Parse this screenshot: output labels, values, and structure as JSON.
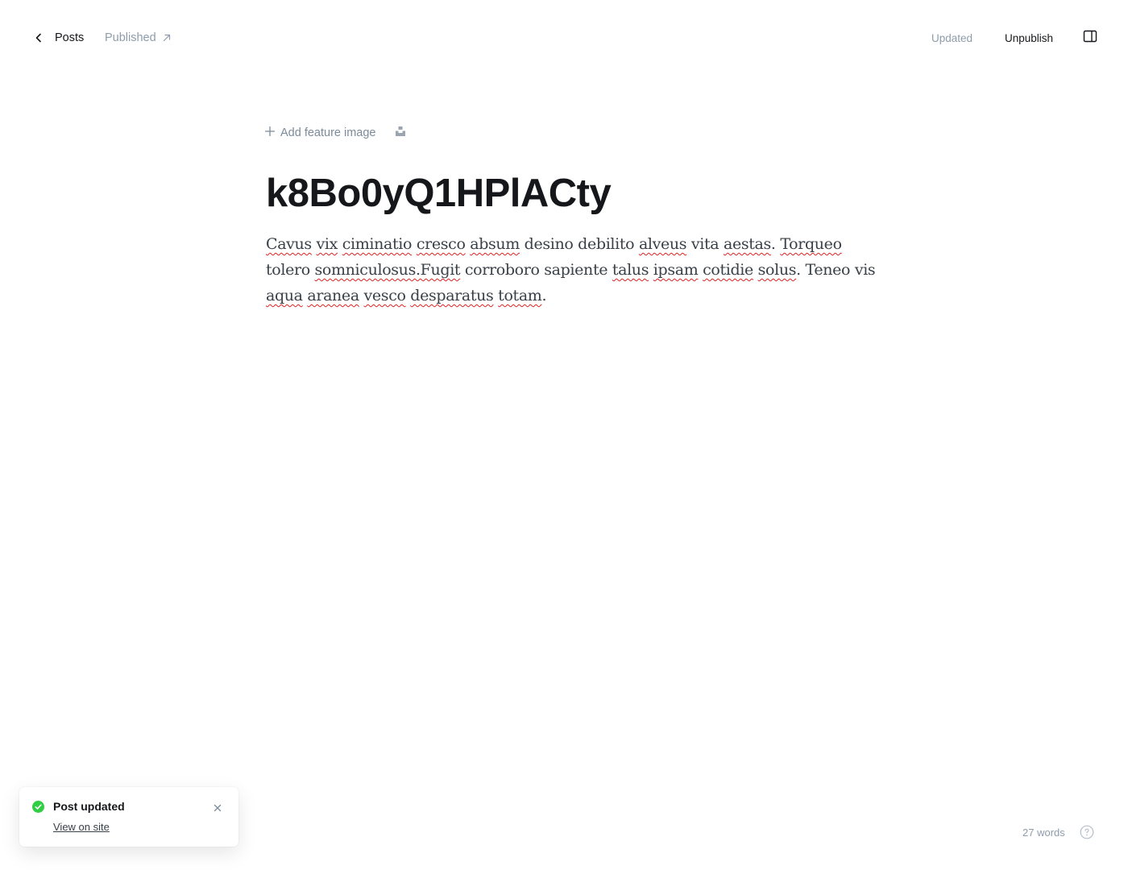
{
  "header": {
    "back_label": "Posts",
    "status_label": "Published",
    "saved_state": "Updated",
    "unpublish_label": "Unpublish"
  },
  "editor": {
    "add_feature_image_label": "Add feature image",
    "title": "k8Bo0yQ1HPlACty",
    "body_segments": [
      {
        "text": "Cavus",
        "spell": true
      },
      {
        "text": " ",
        "spell": false
      },
      {
        "text": "vix",
        "spell": true
      },
      {
        "text": " ",
        "spell": false
      },
      {
        "text": "ciminatio",
        "spell": true
      },
      {
        "text": " ",
        "spell": false
      },
      {
        "text": "cresco",
        "spell": true
      },
      {
        "text": " ",
        "spell": false
      },
      {
        "text": "absum",
        "spell": true
      },
      {
        "text": " desino debilito ",
        "spell": false
      },
      {
        "text": "alveus",
        "spell": true
      },
      {
        "text": " vita ",
        "spell": false
      },
      {
        "text": "aestas",
        "spell": true
      },
      {
        "text": ". ",
        "spell": false
      },
      {
        "text": "Torqueo",
        "spell": true
      },
      {
        "text": " tolero ",
        "spell": false
      },
      {
        "text": "somniculosus.Fugit",
        "spell": true
      },
      {
        "text": " corroboro sapiente ",
        "spell": false
      },
      {
        "text": "talus",
        "spell": true
      },
      {
        "text": " ",
        "spell": false
      },
      {
        "text": "ipsam",
        "spell": true
      },
      {
        "text": " ",
        "spell": false
      },
      {
        "text": "cotidie",
        "spell": true
      },
      {
        "text": " ",
        "spell": false
      },
      {
        "text": "solus",
        "spell": true
      },
      {
        "text": ". Teneo vis ",
        "spell": false
      },
      {
        "text": "aqua",
        "spell": true
      },
      {
        "text": " ",
        "spell": false
      },
      {
        "text": "aranea",
        "spell": true
      },
      {
        "text": " ",
        "spell": false
      },
      {
        "text": "vesco",
        "spell": true
      },
      {
        "text": " ",
        "spell": false
      },
      {
        "text": "desparatus",
        "spell": true
      },
      {
        "text": " ",
        "spell": false
      },
      {
        "text": "totam",
        "spell": true
      },
      {
        "text": ".",
        "spell": false
      }
    ]
  },
  "toast": {
    "title": "Post updated",
    "link_label": "View on site"
  },
  "footer": {
    "word_count": "27 words"
  },
  "icons": {
    "back": "chevron-left-icon",
    "status_link": "arrow-up-right-icon",
    "sidebar": "sidebar-toggle-icon",
    "add": "plus-icon",
    "unsplash": "unsplash-icon",
    "toast_status": "check-circle-icon",
    "toast_close": "close-icon",
    "help": "question-circle-icon"
  },
  "colors": {
    "success": "#30cf43",
    "muted": "#8e9cac",
    "text": "#15171a",
    "spellcheck": "#e02020"
  }
}
